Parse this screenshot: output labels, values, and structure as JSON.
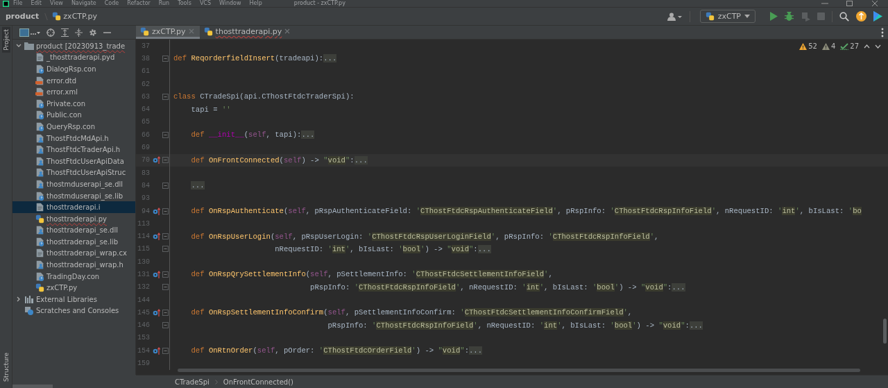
{
  "window": {
    "title": "product - zxCTP.py",
    "menu": [
      "File",
      "Edit",
      "View",
      "Navigate",
      "Code",
      "Refactor",
      "Run",
      "Tools",
      "VCS",
      "Window",
      "Help"
    ]
  },
  "navbar": {
    "project": "product",
    "file": "zxCTP.py"
  },
  "toolbar": {
    "run_config": "zxCTP",
    "actions": [
      {
        "kind": "run",
        "disabled": false
      },
      {
        "kind": "debug",
        "disabled": false
      },
      {
        "kind": "coverage",
        "disabled": true
      },
      {
        "kind": "stop",
        "disabled": true
      }
    ]
  },
  "side_stripe": {
    "top": "Project",
    "bottom": "Structure"
  },
  "project_panel": {
    "tree": [
      {
        "name": "product [20230913_trade",
        "kind": "folder",
        "expanded": true,
        "selected": false,
        "error": true,
        "children": [
          {
            "name": "_thosttraderapi.pyd",
            "kind": "plain",
            "selected": false,
            "error": false
          },
          {
            "name": "DialogRsp.con",
            "kind": "unknown",
            "selected": false,
            "error": false
          },
          {
            "name": "error.dtd",
            "kind": "markup",
            "selected": false,
            "error": false
          },
          {
            "name": "error.xml",
            "kind": "markup",
            "selected": false,
            "error": false
          },
          {
            "name": "Private.con",
            "kind": "unknown",
            "selected": false,
            "error": false
          },
          {
            "name": "Public.con",
            "kind": "unknown",
            "selected": false,
            "error": false
          },
          {
            "name": "QueryRsp.con",
            "kind": "unknown",
            "selected": false,
            "error": false
          },
          {
            "name": "ThostFtdcMdApi.h",
            "kind": "native",
            "selected": false,
            "error": false
          },
          {
            "name": "ThostFtdcTraderApi.h",
            "kind": "native",
            "selected": false,
            "error": false
          },
          {
            "name": "ThostFtdcUserApiData",
            "kind": "native",
            "selected": false,
            "error": false
          },
          {
            "name": "ThostFtdcUserApiStruc",
            "kind": "native",
            "selected": false,
            "error": false
          },
          {
            "name": "thostmduserapi_se.dll",
            "kind": "native",
            "selected": false,
            "error": false
          },
          {
            "name": "thostmduserapi_se.lib",
            "kind": "unknown",
            "selected": false,
            "error": false
          },
          {
            "name": "thosttraderapi.i",
            "kind": "plain",
            "selected": true,
            "error": false
          },
          {
            "name": "thosttraderapi.py",
            "kind": "python",
            "selected": false,
            "error": true
          },
          {
            "name": "thosttraderapi_se.dll",
            "kind": "native",
            "selected": false,
            "error": false
          },
          {
            "name": "thosttraderapi_se.lib",
            "kind": "unknown",
            "selected": false,
            "error": false
          },
          {
            "name": "thosttraderapi_wrap.cx",
            "kind": "plain",
            "selected": false,
            "error": false
          },
          {
            "name": "thosttraderapi_wrap.h",
            "kind": "native",
            "selected": false,
            "error": false
          },
          {
            "name": "TradingDay.con",
            "kind": "unknown",
            "selected": false,
            "error": false
          },
          {
            "name": "zxCTP.py",
            "kind": "python",
            "selected": false,
            "error": false
          }
        ]
      },
      {
        "name": "External Libraries",
        "kind": "library",
        "expanded": false,
        "selected": false,
        "error": false
      },
      {
        "name": "Scratches and Consoles",
        "kind": "scratch",
        "selected": false,
        "error": false
      }
    ]
  },
  "tabs": [
    {
      "label": "zxCTP.py",
      "selected": true,
      "error": false
    },
    {
      "label": "thosttraderapi.py",
      "selected": false,
      "error": true
    }
  ],
  "inspections": [
    {
      "kind": "warning",
      "count": "52"
    },
    {
      "kind": "weak",
      "count": "4"
    },
    {
      "kind": "typo",
      "count": "27"
    }
  ],
  "editor": {
    "lines": [
      {
        "number": "37",
        "marker": false,
        "fold": false,
        "current": false
      },
      {
        "number": "38",
        "marker": false,
        "fold": true,
        "current": false,
        "tokens": [
          {
            "kind": "kw",
            "text": "def "
          },
          {
            "kind": "fn",
            "text": "ReqorderfieldInsert"
          },
          {
            "kind": "plain",
            "text": "(tradeapi):"
          },
          {
            "kind": "fold",
            "text": "..."
          }
        ]
      },
      {
        "number": "61",
        "marker": false,
        "fold": false,
        "current": false
      },
      {
        "number": "62",
        "marker": false,
        "fold": false,
        "current": false
      },
      {
        "number": "63",
        "marker": false,
        "fold": true,
        "current": false,
        "tokens": [
          {
            "kind": "kw",
            "text": "class "
          },
          {
            "kind": "plain",
            "text": "CTradeSpi(api.CThostFtdcTraderSpi):"
          }
        ]
      },
      {
        "number": "64",
        "marker": false,
        "fold": false,
        "current": false,
        "tokens": [
          {
            "kind": "plain",
            "text": "    tapi = "
          },
          {
            "kind": "str",
            "text": "''"
          }
        ]
      },
      {
        "number": "65",
        "marker": false,
        "fold": false,
        "current": false
      },
      {
        "number": "66",
        "marker": false,
        "fold": true,
        "current": false,
        "tokens": [
          {
            "kind": "kw",
            "text": "    def "
          },
          {
            "kind": "magic",
            "text": "__init__"
          },
          {
            "kind": "plain",
            "text": "("
          },
          {
            "kind": "self",
            "text": "self"
          },
          {
            "kind": "plain",
            "text": ", tapi):"
          },
          {
            "kind": "fold",
            "text": "..."
          }
        ]
      },
      {
        "number": "69",
        "marker": false,
        "fold": false,
        "current": false
      },
      {
        "number": "70",
        "marker": true,
        "fold": true,
        "current": true,
        "tokens": [
          {
            "kind": "kw",
            "text": "    def "
          },
          {
            "kind": "fn",
            "text": "OnFrontConnected"
          },
          {
            "kind": "plain",
            "text": "("
          },
          {
            "kind": "self",
            "text": "self"
          },
          {
            "kind": "plain",
            "text": ") -> "
          },
          {
            "kind": "str",
            "text": "\""
          },
          {
            "kind": "type",
            "text": "void"
          },
          {
            "kind": "str",
            "text": "\""
          },
          {
            "kind": "plain",
            "text": ":"
          },
          {
            "kind": "fold",
            "text": "..."
          }
        ]
      },
      {
        "number": "83",
        "marker": false,
        "fold": false,
        "current": false
      },
      {
        "number": "84",
        "marker": false,
        "fold": true,
        "current": false,
        "tokens": [
          {
            "kind": "fold",
            "text": "    ..."
          }
        ]
      },
      {
        "number": "93",
        "marker": false,
        "fold": false,
        "current": false
      },
      {
        "number": "94",
        "marker": true,
        "fold": true,
        "current": false,
        "tokens": [
          {
            "kind": "kw",
            "text": "    def "
          },
          {
            "kind": "fn",
            "text": "OnRspAuthenticate"
          },
          {
            "kind": "plain",
            "text": "("
          },
          {
            "kind": "self",
            "text": "self"
          },
          {
            "kind": "plain",
            "text": ", pRspAuthenticateField: "
          },
          {
            "kind": "str",
            "text": "'"
          },
          {
            "kind": "type",
            "text": "CThostFtdcRspAuthenticateField"
          },
          {
            "kind": "str",
            "text": "'"
          },
          {
            "kind": "plain",
            "text": ", pRspInfo: "
          },
          {
            "kind": "str",
            "text": "'"
          },
          {
            "kind": "type",
            "text": "CThostFtdcRspInfoField"
          },
          {
            "kind": "str",
            "text": "'"
          },
          {
            "kind": "plain",
            "text": ", nRequestID: "
          },
          {
            "kind": "str",
            "text": "'"
          },
          {
            "kind": "type",
            "text": "int"
          },
          {
            "kind": "str",
            "text": "'"
          },
          {
            "kind": "plain",
            "text": ", bIsLast: "
          },
          {
            "kind": "str",
            "text": "'"
          },
          {
            "kind": "type",
            "text": "bo"
          }
        ]
      },
      {
        "number": "113",
        "marker": false,
        "fold": false,
        "current": false
      },
      {
        "number": "114",
        "marker": true,
        "fold": true,
        "current": false,
        "tokens": [
          {
            "kind": "kw",
            "text": "    def "
          },
          {
            "kind": "fn",
            "text": "OnRspUserLogin"
          },
          {
            "kind": "plain",
            "text": "("
          },
          {
            "kind": "self",
            "text": "self"
          },
          {
            "kind": "plain",
            "text": ", pRspUserLogin: "
          },
          {
            "kind": "str",
            "text": "'"
          },
          {
            "kind": "type",
            "text": "CThostFtdcRspUserLoginField"
          },
          {
            "kind": "str",
            "text": "'"
          },
          {
            "kind": "plain",
            "text": ", pRspInfo: "
          },
          {
            "kind": "str",
            "text": "'"
          },
          {
            "kind": "type",
            "text": "CThostFtdcRspInfoField"
          },
          {
            "kind": "str",
            "text": "'"
          },
          {
            "kind": "plain",
            "text": ","
          }
        ]
      },
      {
        "number": "115",
        "marker": false,
        "fold": true,
        "current": false,
        "tokens": [
          {
            "kind": "plain",
            "text": "                       nRequestID: "
          },
          {
            "kind": "str",
            "text": "'"
          },
          {
            "kind": "type",
            "text": "int"
          },
          {
            "kind": "str",
            "text": "'"
          },
          {
            "kind": "plain",
            "text": ", bIsLast: "
          },
          {
            "kind": "str",
            "text": "'"
          },
          {
            "kind": "type",
            "text": "bool"
          },
          {
            "kind": "str",
            "text": "'"
          },
          {
            "kind": "plain",
            "text": ") -> "
          },
          {
            "kind": "str",
            "text": "\""
          },
          {
            "kind": "type",
            "text": "void"
          },
          {
            "kind": "str",
            "text": "\""
          },
          {
            "kind": "plain",
            "text": ":"
          },
          {
            "kind": "fold",
            "text": "..."
          }
        ]
      },
      {
        "number": "130",
        "marker": false,
        "fold": false,
        "current": false
      },
      {
        "number": "131",
        "marker": true,
        "fold": true,
        "current": false,
        "tokens": [
          {
            "kind": "kw",
            "text": "    def "
          },
          {
            "kind": "fn",
            "text": "OnRspQrySettlementInfo"
          },
          {
            "kind": "plain",
            "text": "("
          },
          {
            "kind": "self",
            "text": "self"
          },
          {
            "kind": "plain",
            "text": ", pSettlementInfo: "
          },
          {
            "kind": "str",
            "text": "'"
          },
          {
            "kind": "type",
            "text": "CThostFtdcSettlementInfoField"
          },
          {
            "kind": "str",
            "text": "'"
          },
          {
            "kind": "plain",
            "text": ","
          }
        ]
      },
      {
        "number": "132",
        "marker": false,
        "fold": true,
        "current": false,
        "tokens": [
          {
            "kind": "plain",
            "text": "                               pRspInfo: "
          },
          {
            "kind": "str",
            "text": "'"
          },
          {
            "kind": "type",
            "text": "CThostFtdcRspInfoField"
          },
          {
            "kind": "str",
            "text": "'"
          },
          {
            "kind": "plain",
            "text": ", nRequestID: "
          },
          {
            "kind": "str",
            "text": "'"
          },
          {
            "kind": "type",
            "text": "int"
          },
          {
            "kind": "str",
            "text": "'"
          },
          {
            "kind": "plain",
            "text": ", bIsLast: "
          },
          {
            "kind": "str",
            "text": "'"
          },
          {
            "kind": "type",
            "text": "bool"
          },
          {
            "kind": "str",
            "text": "'"
          },
          {
            "kind": "plain",
            "text": ") -> "
          },
          {
            "kind": "str",
            "text": "\""
          },
          {
            "kind": "type",
            "text": "void"
          },
          {
            "kind": "str",
            "text": "\""
          },
          {
            "kind": "plain",
            "text": ":"
          },
          {
            "kind": "fold",
            "text": "..."
          }
        ]
      },
      {
        "number": "144",
        "marker": false,
        "fold": false,
        "current": false
      },
      {
        "number": "145",
        "marker": true,
        "fold": true,
        "current": false,
        "tokens": [
          {
            "kind": "kw",
            "text": "    def "
          },
          {
            "kind": "fn",
            "text": "OnRspSettlementInfoConfirm"
          },
          {
            "kind": "plain",
            "text": "("
          },
          {
            "kind": "self",
            "text": "self"
          },
          {
            "kind": "plain",
            "text": ", pSettlementInfoConfirm: "
          },
          {
            "kind": "str",
            "text": "'"
          },
          {
            "kind": "type",
            "text": "CThostFtdcSettlementInfoConfirmField"
          },
          {
            "kind": "str",
            "text": "'"
          },
          {
            "kind": "plain",
            "text": ","
          }
        ]
      },
      {
        "number": "146",
        "marker": false,
        "fold": true,
        "current": false,
        "tokens": [
          {
            "kind": "plain",
            "text": "                                   pRspInfo: "
          },
          {
            "kind": "str",
            "text": "'"
          },
          {
            "kind": "type",
            "text": "CThostFtdcRspInfoField"
          },
          {
            "kind": "str",
            "text": "'"
          },
          {
            "kind": "plain",
            "text": ", nRequestID: "
          },
          {
            "kind": "str",
            "text": "'"
          },
          {
            "kind": "type",
            "text": "int"
          },
          {
            "kind": "str",
            "text": "'"
          },
          {
            "kind": "plain",
            "text": ", bIsLast: "
          },
          {
            "kind": "str",
            "text": "'"
          },
          {
            "kind": "type",
            "text": "bool"
          },
          {
            "kind": "str",
            "text": "'"
          },
          {
            "kind": "plain",
            "text": ") -> "
          },
          {
            "kind": "str",
            "text": "\""
          },
          {
            "kind": "type",
            "text": "void"
          },
          {
            "kind": "str",
            "text": "\""
          },
          {
            "kind": "plain",
            "text": ":"
          },
          {
            "kind": "fold",
            "text": "..."
          }
        ]
      },
      {
        "number": "153",
        "marker": false,
        "fold": false,
        "current": false
      },
      {
        "number": "154",
        "marker": true,
        "fold": true,
        "current": false,
        "tokens": [
          {
            "kind": "kw",
            "text": "    def "
          },
          {
            "kind": "fn",
            "text": "OnRtnOrder"
          },
          {
            "kind": "plain",
            "text": "("
          },
          {
            "kind": "self",
            "text": "self"
          },
          {
            "kind": "plain",
            "text": ", pOrder: "
          },
          {
            "kind": "str",
            "text": "'"
          },
          {
            "kind": "type",
            "text": "CThostFtdcOrderField"
          },
          {
            "kind": "str",
            "text": "'"
          },
          {
            "kind": "plain",
            "text": ") -> "
          },
          {
            "kind": "str",
            "text": "\""
          },
          {
            "kind": "type",
            "text": "void"
          },
          {
            "kind": "str",
            "text": "\""
          },
          {
            "kind": "plain",
            "text": ":"
          },
          {
            "kind": "fold",
            "text": "..."
          }
        ]
      },
      {
        "number": "159",
        "marker": false,
        "fold": false,
        "current": false
      }
    ]
  },
  "breadcrumbs": [
    "CTradeSpi",
    "OnFrontConnected()"
  ]
}
